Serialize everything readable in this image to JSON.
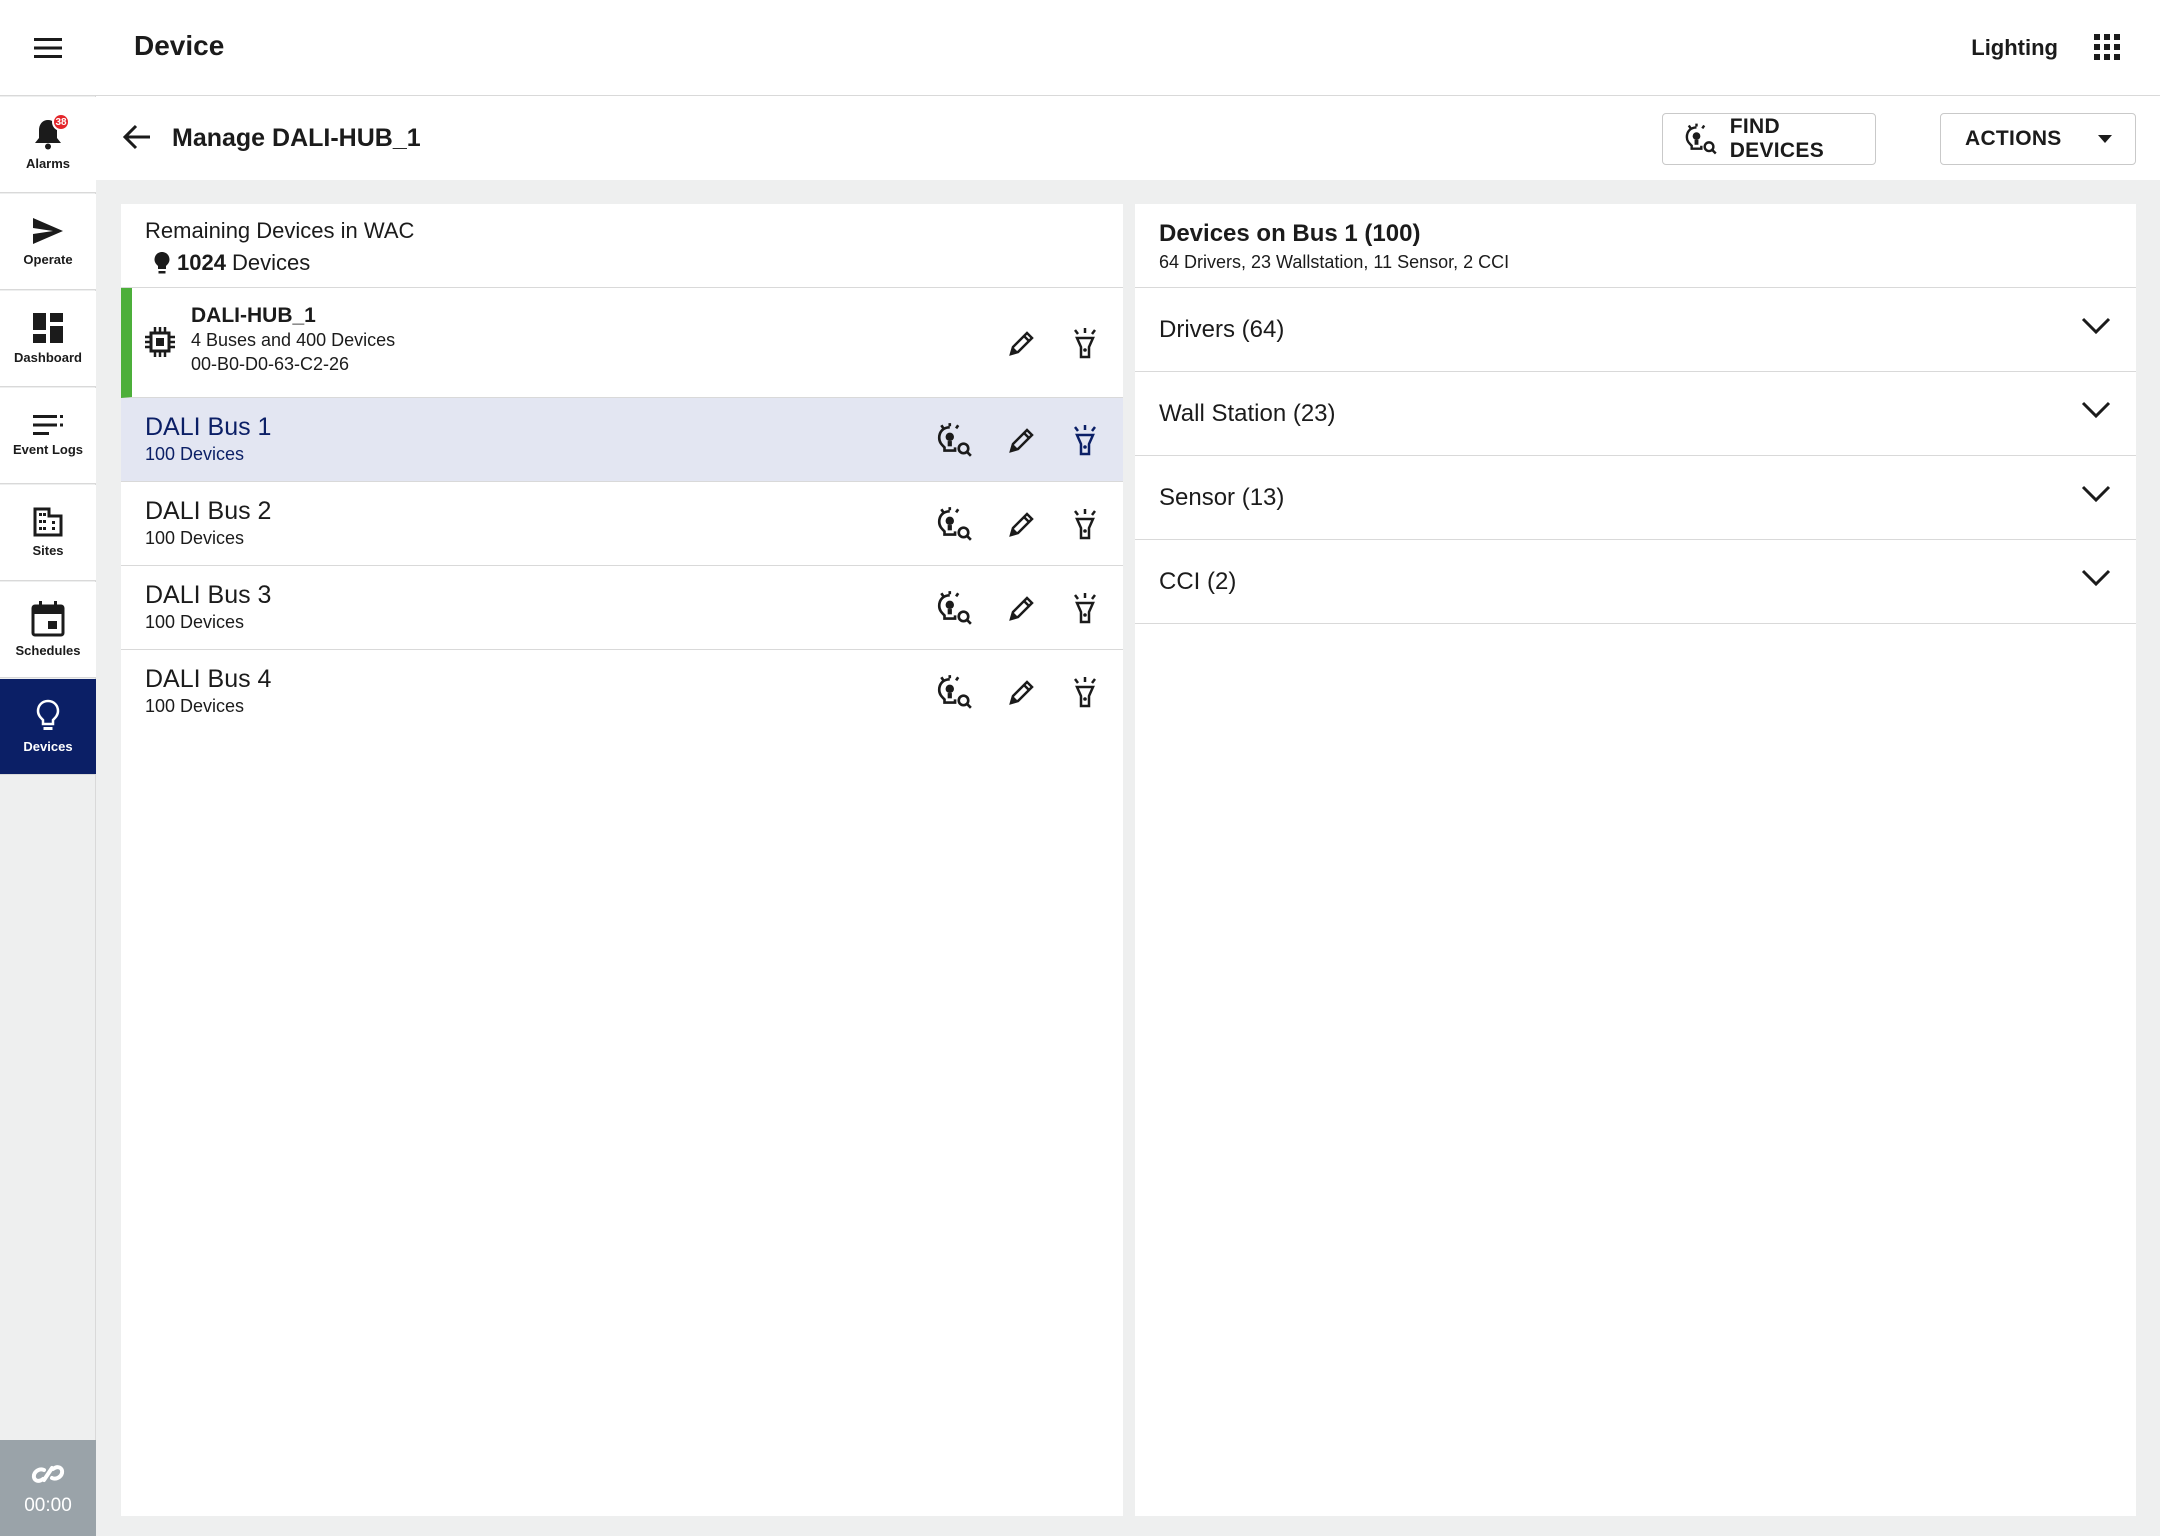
{
  "sidebar": {
    "menu_icon": "menu-icon",
    "items": [
      {
        "label": "Alarms",
        "icon": "bell-icon",
        "badge": "38"
      },
      {
        "label": "Operate",
        "icon": "send-icon"
      },
      {
        "label": "Dashboard",
        "icon": "dashboard-icon"
      },
      {
        "label": "Event Logs",
        "icon": "list-icon"
      },
      {
        "label": "Sites",
        "icon": "building-icon"
      },
      {
        "label": "Schedules",
        "icon": "calendar-icon"
      },
      {
        "label": "Devices",
        "icon": "lightbulb-icon",
        "active": true
      }
    ],
    "timer": "00:00"
  },
  "header": {
    "title": "Device",
    "app_name": "Lighting"
  },
  "subheader": {
    "title": "Manage DALI-HUB_1",
    "find_devices": "FIND DEVICES",
    "actions": "ACTIONS"
  },
  "left": {
    "remaining_label": "Remaining Devices in WAC",
    "remaining_count": "1024",
    "remaining_unit": "Devices",
    "hub": {
      "name": "DALI-HUB_1",
      "summary": "4 Buses and 400 Devices",
      "mac": "00-B0-D0-63-C2-26"
    },
    "buses": [
      {
        "name": "DALI Bus 1",
        "count": "100 Devices",
        "selected": true
      },
      {
        "name": "DALI Bus 2",
        "count": "100 Devices"
      },
      {
        "name": "DALI Bus 3",
        "count": "100 Devices"
      },
      {
        "name": "DALI Bus 4",
        "count": "100 Devices"
      }
    ]
  },
  "right": {
    "title": "Devices on Bus 1 (100)",
    "subtitle": "64 Drivers, 23 Wallstation, 11 Sensor, 2 CCI",
    "groups": [
      {
        "label": "Drivers (64)"
      },
      {
        "label": "Wall Station (23)"
      },
      {
        "label": "Sensor (13)"
      },
      {
        "label": "CCI (2)"
      }
    ]
  },
  "colors": {
    "accent": "#0b1f66",
    "selected_row": "#e3e6f2",
    "hub_status": "#4caf3a",
    "alarm_badge": "#e4262b"
  }
}
